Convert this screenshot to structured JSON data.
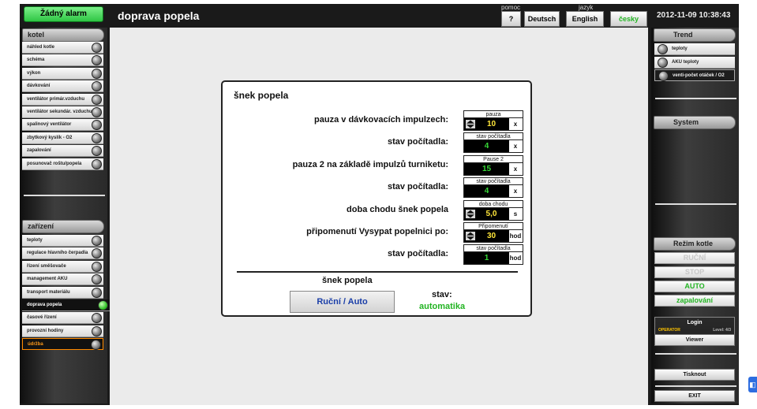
{
  "header": {
    "alarm": "Žádný alarm",
    "title": "doprava popela",
    "help_label": "pomoc",
    "help_button": "?",
    "language_label": "jazyk",
    "languages": [
      "Deutsch",
      "English",
      "česky"
    ],
    "active_language": "česky",
    "datetime": "2012-11-09 10:38:43"
  },
  "left": {
    "boiler_header": "kotel",
    "boiler_items": [
      "náhled kotle",
      "schéma",
      "výkon",
      "dávkování",
      "ventilátor primár.vzduchu",
      "ventilátor sekundár. vzduchu",
      "spalinový ventilátor",
      "zbytkový kyslík - O2",
      "zapalování",
      "posunovač roštu/popela"
    ],
    "equipment_header": "zařízení",
    "equipment_items": [
      "teploty",
      "regulace hlavního čerpadla",
      "řízení směšovače",
      "management AKU",
      "transport materiálu",
      "doprava popela",
      "časové řízení",
      "provozní hodiny",
      "údržba"
    ],
    "active_item": "doprava popela",
    "alert_item": "údržba"
  },
  "right": {
    "trend_header": "Trend",
    "trend_items": [
      "teploty",
      "AKU teploty",
      "venti-počet otáček / O2"
    ],
    "system_header": "System",
    "mode_header": "Režim kotle",
    "modes": [
      {
        "label": "RUČNÍ",
        "color": "#c8c8c8"
      },
      {
        "label": "STOP",
        "color": "#c8c8c8"
      },
      {
        "label": "AUTO",
        "color": "#22b422"
      },
      {
        "label": "zapalování",
        "color": "#22b422"
      }
    ],
    "login": "Login",
    "operator": "OPERATOR",
    "level": "Level: 4/3",
    "viewer": "Viewer",
    "print": "Tisknout",
    "exit": "EXIT"
  },
  "dialog": {
    "title": "šnek popela",
    "params": [
      {
        "label": "pauza v dávkovacích impulzech:",
        "caption": "pauza",
        "value": "10",
        "unit": "x",
        "color": "yellow",
        "arrows": true
      },
      {
        "label": "stav počítadla:",
        "caption": "stav počítadla",
        "value": "4",
        "unit": "x",
        "color": "green",
        "arrows": false
      },
      {
        "label": "pauza 2 na základě impulzů turniketu:",
        "caption": "Pause 2",
        "value": "15",
        "unit": "x",
        "color": "green",
        "arrows": false
      },
      {
        "label": "stav počítadla:",
        "caption": "stav počítadla",
        "value": "4",
        "unit": "x",
        "color": "green",
        "arrows": false
      },
      {
        "label": "doba chodu šnek popela",
        "caption": "doba chodu",
        "value": "5,0",
        "unit": "s",
        "color": "yellow",
        "arrows": true
      },
      {
        "label": "připomenutí Vysypat popelnici po:",
        "caption": "Připomenutí",
        "value": "30",
        "unit": "hod",
        "color": "yellow",
        "arrows": true
      },
      {
        "label": "stav počítadla:",
        "caption": "stav počítadla",
        "value": "1",
        "unit": "hod",
        "color": "green",
        "arrows": false
      }
    ],
    "sub_title": "šnek popela",
    "mode_button": "Ruční / Auto",
    "state_label": "stav:",
    "state_value": "automatika"
  }
}
